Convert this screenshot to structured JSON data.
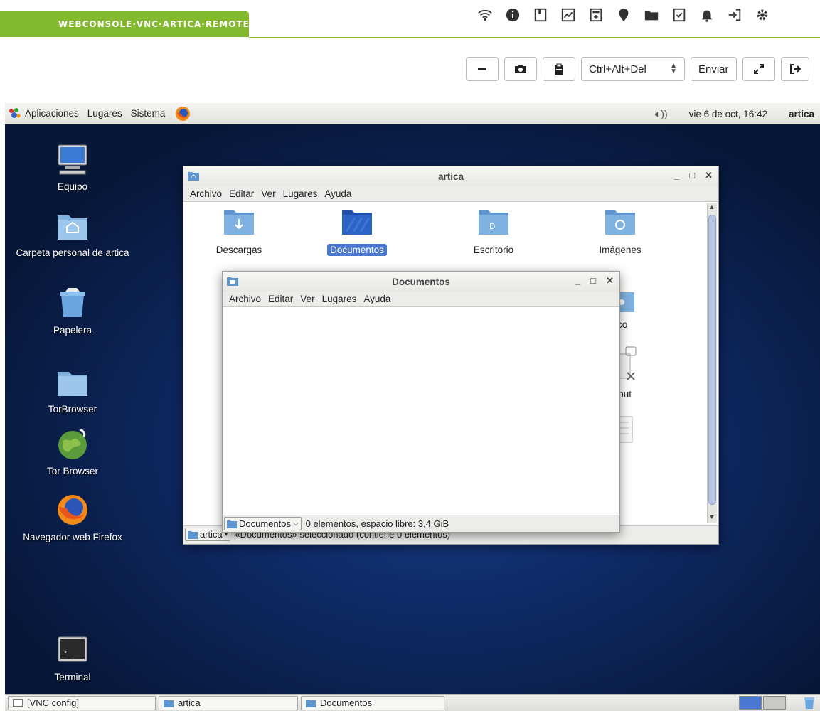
{
  "console": {
    "tab_label": "WEBCONSOLE·VNC·ARTICA·REMOTE",
    "accent": "#82b92e",
    "top_icons": [
      "wifi-icon",
      "info-circle-icon",
      "bookmark-icon",
      "chart-icon",
      "calculator-icon",
      "map-pin-icon",
      "folder-icon",
      "checklist-icon",
      "bell-icon",
      "logout-icon",
      "gear-icon"
    ]
  },
  "vnc_toolbar": {
    "minimize_icon": "minus-icon",
    "screenshot_icon": "camera-icon",
    "clipboard_icon": "clipboard-icon",
    "key_combo_value": "Ctrl+Alt+Del",
    "send_label": "Enviar",
    "fullscreen_icon": "expand-icon",
    "exit_icon": "exit-icon"
  },
  "top_panel": {
    "menus": [
      "Aplicaciones",
      "Lugares",
      "Sistema"
    ],
    "clock": "vie 6 de oct, 16:42",
    "user": "artica"
  },
  "desktop_icons": [
    {
      "label": "Equipo",
      "icon": "computer-icon"
    },
    {
      "label": "Carpeta personal de artica",
      "icon": "home-folder-icon"
    },
    {
      "label": "Papelera",
      "icon": "trash-icon"
    },
    {
      "label": "TorBrowser",
      "icon": "folder-icon"
    },
    {
      "label": "Tor Browser",
      "icon": "tor-browser-icon"
    },
    {
      "label": "Navegador web Firefox",
      "icon": "firefox-icon"
    },
    {
      "label": "Terminal",
      "icon": "terminal-icon"
    }
  ],
  "window_artica": {
    "title": "artica",
    "menu": [
      "Archivo",
      "Editar",
      "Ver",
      "Lugares",
      "Ayuda"
    ],
    "items": [
      {
        "label": "Descargas",
        "icon": "downloads-folder-icon"
      },
      {
        "label": "Documentos",
        "icon": "documents-folder-icon",
        "selected": true
      },
      {
        "label": "Escritorio",
        "icon": "desktop-folder-icon"
      },
      {
        "label": "Imágenes",
        "icon": "pictures-folder-icon"
      }
    ],
    "partial_labels": [
      "lico",
      "p.out",
      "x"
    ],
    "path_label": "artica",
    "status": "«Documentos» seleccionado (contiene 0 elementos)"
  },
  "window_documentos": {
    "title": "Documentos",
    "menu": [
      "Archivo",
      "Editar",
      "Ver",
      "Lugares",
      "Ayuda"
    ],
    "path_label": "Documentos",
    "status": "0 elementos, espacio libre: 3,4 GiB"
  },
  "taskbar": {
    "tasks": [
      "[VNC config]",
      "artica",
      "Documentos"
    ]
  }
}
